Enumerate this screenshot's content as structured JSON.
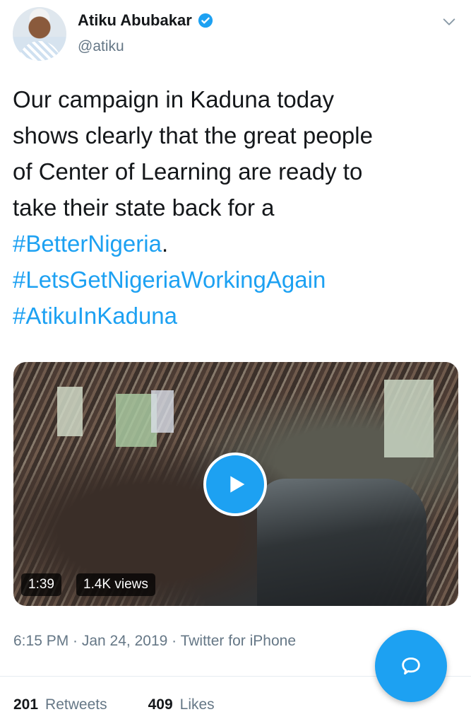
{
  "author": {
    "name": "Atiku Abubakar",
    "handle": "@atiku"
  },
  "tweet": {
    "text_lines": [
      "Our campaign in Kaduna today",
      "shows clearly that the great people",
      "of Center of Learning are ready to",
      "take their state back for a"
    ],
    "hashtag1": "#BetterNigeria",
    "hashtag1_suffix": ".",
    "hashtag2": "#LetsGetNigeriaWorkingAgain",
    "hashtag3": "#AtikuInKaduna"
  },
  "media": {
    "duration": "1:39",
    "views": "1.4K views"
  },
  "meta": {
    "timestamp": "6:15 PM · Jan 24, 2019 · Twitter for iPhone"
  },
  "stats": {
    "retweets_count": "201",
    "retweets_label": "Retweets",
    "likes_count": "409",
    "likes_label": "Likes"
  },
  "colors": {
    "accent": "#1da1f2",
    "secondary_text": "#657786",
    "primary_text": "#14171a"
  },
  "icons": {
    "verified": "verified-badge-icon",
    "caret": "chevron-down-icon",
    "play": "play-icon",
    "compose": "reply-bubble-icon"
  }
}
